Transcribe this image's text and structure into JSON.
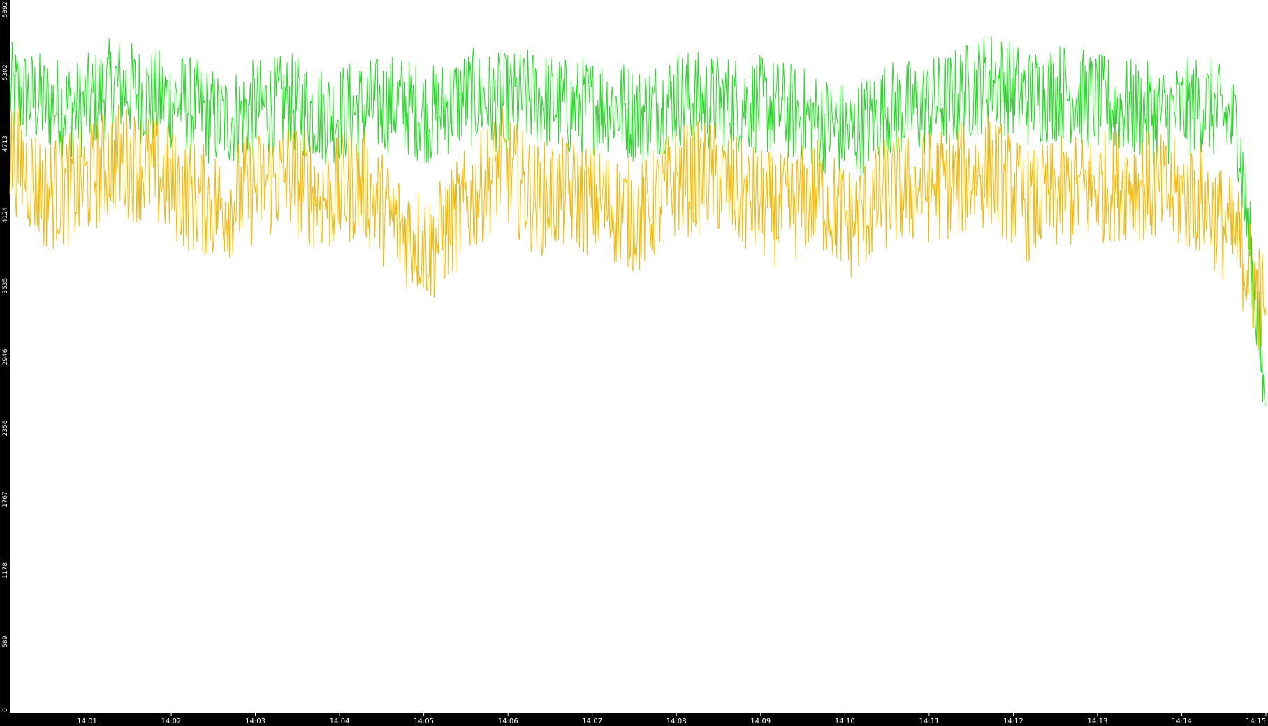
{
  "chart_data": {
    "type": "line",
    "title": "",
    "xlabel": "",
    "ylabel": "",
    "ylim": [
      0,
      5892
    ],
    "y_ticks": [
      "0",
      "589",
      "1178",
      "1767",
      "2356",
      "2946",
      "3535",
      "4124",
      "4713",
      "5302",
      "5892"
    ],
    "x_ticks": [
      "14:01",
      "14:02",
      "14:03",
      "14:04",
      "14:05",
      "14:06",
      "14:07",
      "14:08",
      "14:09",
      "14:10",
      "14:11",
      "14:12",
      "14:13",
      "14:14",
      "14:15"
    ],
    "x_range": [
      "14:00:05",
      "14:15:00"
    ],
    "grid": false,
    "legend": "none",
    "axis_background": "#000000",
    "axis_text_color": "#ffffff",
    "series": [
      {
        "color": "#22dd22",
        "x": [
          "14:00:05",
          "14:00:30",
          "14:00:55",
          "14:01:20",
          "14:01:45",
          "14:02:10",
          "14:02:35",
          "14:03:00",
          "14:03:25",
          "14:03:50",
          "14:04:15",
          "14:04:40",
          "14:05:05",
          "14:05:30",
          "14:05:55",
          "14:06:20",
          "14:06:45",
          "14:07:10",
          "14:07:35",
          "14:08:00",
          "14:08:25",
          "14:08:50",
          "14:09:15",
          "14:09:40",
          "14:10:05",
          "14:10:30",
          "14:10:55",
          "14:11:20",
          "14:11:45",
          "14:12:10",
          "14:12:35",
          "14:13:00",
          "14:13:25",
          "14:13:50",
          "14:14:15",
          "14:14:40",
          "14:15:00"
        ],
        "values": [
          5150,
          5050,
          5000,
          5200,
          5100,
          5050,
          4900,
          5000,
          5050,
          4950,
          5000,
          5050,
          4950,
          5100,
          5050,
          5100,
          5000,
          5050,
          4950,
          5100,
          5050,
          5050,
          5000,
          4900,
          4800,
          5000,
          5000,
          5100,
          5250,
          5100,
          5150,
          5050,
          5000,
          4950,
          5050,
          4850,
          2550
        ]
      },
      {
        "color": "#f5b800",
        "x": [
          "14:00:05",
          "14:00:30",
          "14:00:55",
          "14:01:20",
          "14:01:45",
          "14:02:10",
          "14:02:35",
          "14:03:00",
          "14:03:25",
          "14:03:50",
          "14:04:15",
          "14:04:40",
          "14:05:05",
          "14:05:30",
          "14:05:55",
          "14:06:20",
          "14:06:45",
          "14:07:10",
          "14:07:35",
          "14:08:00",
          "14:08:25",
          "14:08:50",
          "14:09:15",
          "14:09:40",
          "14:10:05",
          "14:10:30",
          "14:10:55",
          "14:11:20",
          "14:11:45",
          "14:12:10",
          "14:12:35",
          "14:13:00",
          "14:13:25",
          "14:13:50",
          "14:14:15",
          "14:14:40",
          "14:15:00"
        ],
        "values": [
          4650,
          4300,
          4350,
          4600,
          4500,
          4300,
          4200,
          4350,
          4450,
          4250,
          4400,
          4050,
          3850,
          4200,
          4550,
          4250,
          4300,
          4200,
          4100,
          4400,
          4450,
          4250,
          4150,
          4300,
          4050,
          4300,
          4350,
          4400,
          4500,
          4200,
          4300,
          4350,
          4400,
          4300,
          4250,
          3900,
          3300
        ]
      }
    ]
  }
}
